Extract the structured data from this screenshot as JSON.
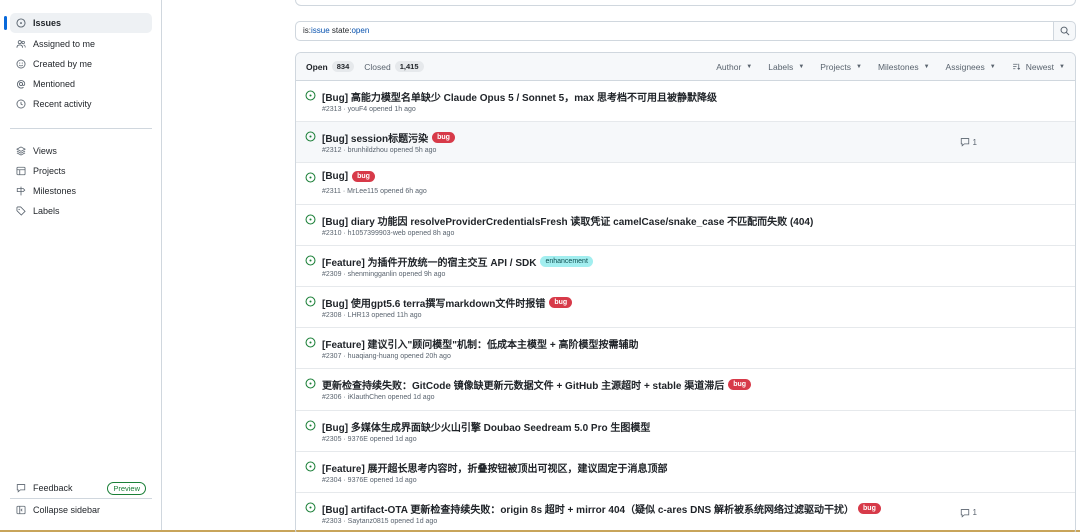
{
  "sidebar": {
    "items": [
      {
        "label": "Issues",
        "icon": "issue-opened-icon",
        "active": true
      },
      {
        "label": "Assigned to me",
        "icon": "people-icon"
      },
      {
        "label": "Created by me",
        "icon": "smiley-icon"
      },
      {
        "label": "Mentioned",
        "icon": "mention-icon"
      },
      {
        "label": "Recent activity",
        "icon": "clock-icon"
      }
    ],
    "views": [
      {
        "label": "Views",
        "icon": "stack-icon"
      },
      {
        "label": "Projects",
        "icon": "table-icon"
      },
      {
        "label": "Milestones",
        "icon": "milestone-icon"
      },
      {
        "label": "Labels",
        "icon": "tag-icon"
      }
    ],
    "feedback": {
      "label": "Feedback",
      "badge": "Preview"
    },
    "collapse": {
      "label": "Collapse sidebar"
    }
  },
  "search": {
    "prefix": "is:",
    "kw1": "issue",
    "mid": " state:",
    "kw2": "open"
  },
  "header": {
    "open_label": "Open",
    "open_count": "834",
    "closed_label": "Closed",
    "closed_count": "1,415",
    "filters": [
      "Author",
      "Labels",
      "Projects",
      "Milestones",
      "Assignees"
    ],
    "sort": "Newest"
  },
  "issues": [
    {
      "title": "[Bug] 高能力模型名单缺少 Claude Opus 5 / Sonnet 5，max 思考档不可用且被静默降级",
      "meta": "#2313 · youF4 opened 1h ago"
    },
    {
      "title": "[Bug] session标题污染",
      "label": "bug",
      "meta": "#2312 · brunhildzhou opened 5h ago",
      "comments": "1"
    },
    {
      "title": "[Bug]",
      "label": "bug",
      "meta": "#2311 · MrLee115 opened 6h ago"
    },
    {
      "title": "[Bug] diary 功能因 resolveProviderCredentialsFresh 读取凭证 camelCase/snake_case 不匹配而失败 (404)",
      "meta": "#2310 · h1057399903-web opened 8h ago"
    },
    {
      "title": "[Feature] 为插件开放统一的宿主交互 API / SDK",
      "label": "enhancement",
      "meta": "#2309 · shenmingganlin opened 9h ago"
    },
    {
      "title": "[Bug] 使用gpt5.6 terra撰写markdown文件时报错",
      "label": "bug",
      "meta": "#2308 · LHR13 opened 11h ago"
    },
    {
      "title": "[Feature] 建议引入\"顾问模型\"机制：低成本主模型 + 高阶模型按需辅助",
      "meta": "#2307 · huaqiang-huang opened 20h ago"
    },
    {
      "title": "更新检查持续失败：GitCode 镜像缺更新元数据文件 + GitHub 主源超时 + stable 渠道滞后",
      "label": "bug",
      "meta": "#2306 · iKlauthChen opened 1d ago"
    },
    {
      "title": "[Bug] 多媒体生成界面缺少火山引擎 Doubao Seedream 5.0 Pro 生图模型",
      "meta": "#2305 · 9376E opened 1d ago"
    },
    {
      "title": "[Feature] 展开超长思考内容时，折叠按钮被顶出可视区，建议固定于消息顶部",
      "meta": "#2304 · 9376E opened 1d ago"
    },
    {
      "title": "[Bug] artifact-OTA 更新检查持续失败：origin 8s 超时 + mirror 404（疑似 c-ares DNS 解析被系统网络过滤驱动干扰）",
      "label": "bug",
      "meta": "#2303 · Saytanz0815 opened 1d ago",
      "comments": "1"
    }
  ],
  "colors": {
    "accent": "#0969da",
    "open": "#1a7f37",
    "bug": "#d73a49",
    "enhancement": "#a2eeef"
  }
}
